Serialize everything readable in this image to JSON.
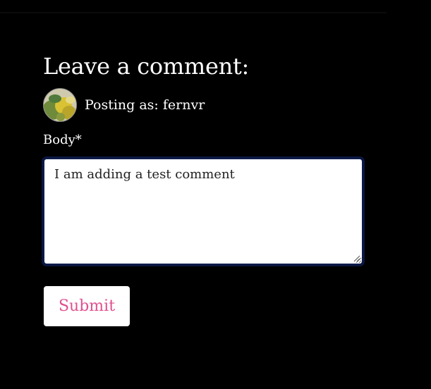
{
  "form": {
    "heading": "Leave a comment:",
    "posting_as": "Posting as: fernvr",
    "avatar_icon": "user-avatar-photo",
    "body_label": "Body*",
    "body_value": "I am adding a test comment",
    "submit_label": "Submit"
  },
  "colors": {
    "background": "#000000",
    "text": "#ffffff",
    "submit_text": "#e0508f",
    "textarea_border": "#0d1b4a"
  }
}
